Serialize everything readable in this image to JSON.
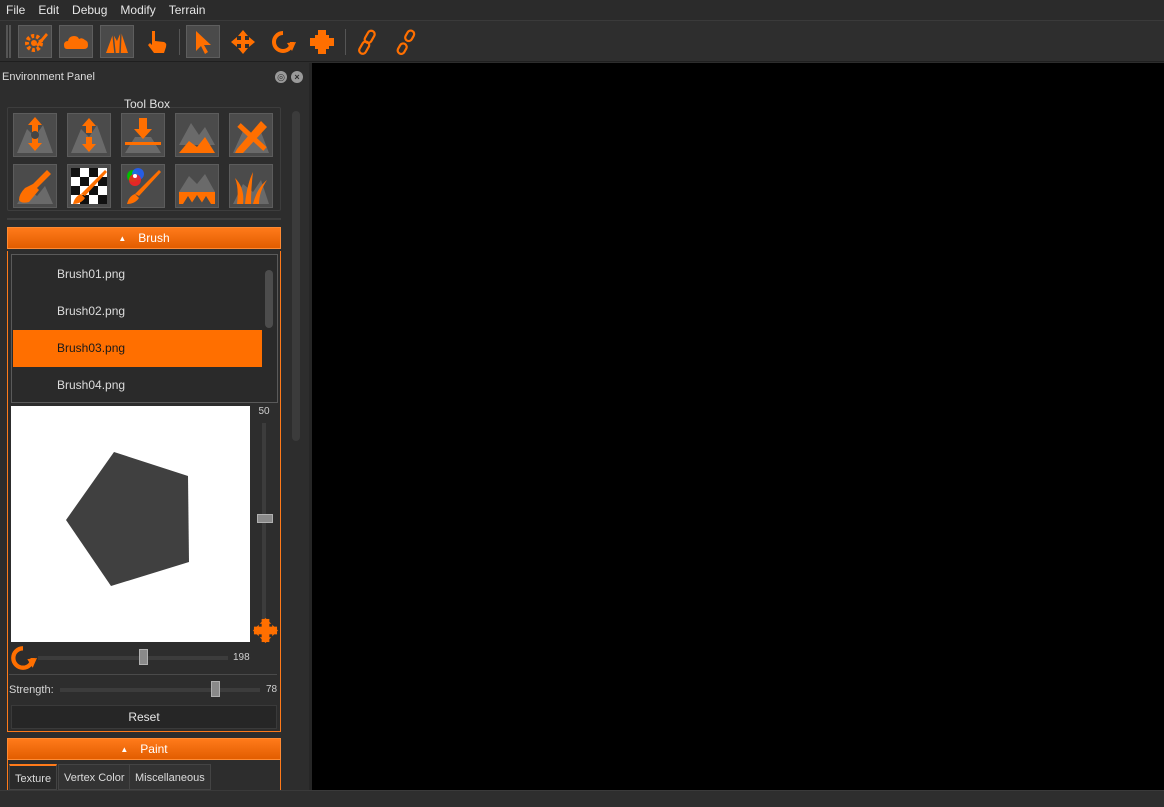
{
  "menu": [
    "File",
    "Edit",
    "Debug",
    "Modify",
    "Terrain"
  ],
  "toolbar": {
    "buttons": [
      {
        "icon": "gear-pencil-icon",
        "active": true
      },
      {
        "icon": "cloud-icon",
        "active": true
      },
      {
        "icon": "terrain-icon",
        "active": true
      },
      {
        "icon": "hand-pointer-icon",
        "active": false
      },
      {
        "icon": "select-arrow-icon",
        "active": true
      },
      {
        "icon": "move-arrows-icon",
        "active": false
      },
      {
        "icon": "rotate-icon",
        "active": false
      },
      {
        "icon": "scale-icon",
        "active": false
      },
      {
        "icon": "link-icon",
        "active": false
      },
      {
        "icon": "unlink-icon",
        "active": false
      }
    ]
  },
  "panel": {
    "title": "Environment Panel",
    "toolbox": {
      "label": "Tool Box",
      "tools": [
        "raise-lower-icon",
        "smooth-icon",
        "flatten-icon",
        "terrain-icon",
        "edit-pencil-icon",
        "dig-shovel-icon",
        "paint-checker-icon",
        "vertex-color-icon",
        "terrain-holes-icon",
        "grass-icon"
      ]
    },
    "brush": {
      "header": "Brush",
      "items": [
        "Brush01.png",
        "Brush02.png",
        "Brush03.png",
        "Brush04.png"
      ],
      "selected_index": 2,
      "size_value": "50",
      "rotation_value": "198",
      "strength_label": "Strength:",
      "strength_value": "78",
      "reset_label": "Reset"
    },
    "paint": {
      "header": "Paint",
      "tabs": [
        "Texture",
        "Vertex Color",
        "Miscellaneous"
      ],
      "active_tab": 0
    }
  },
  "colors": {
    "accent": "#ff6f00",
    "panel_bg": "#2d2d2d",
    "viewport_bg": "#000000"
  }
}
